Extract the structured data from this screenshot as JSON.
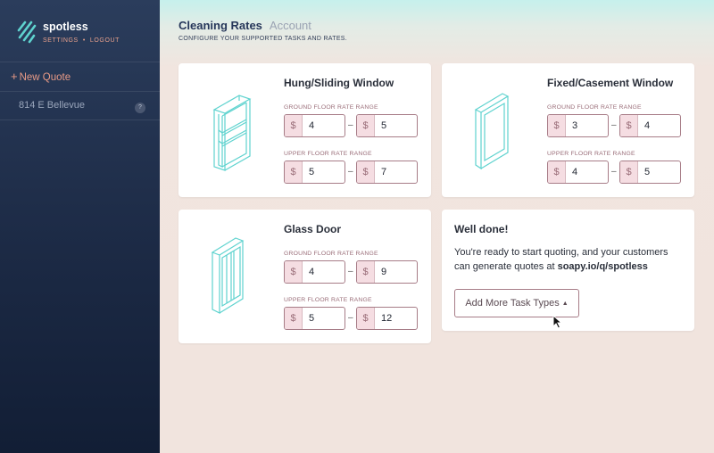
{
  "sidebar": {
    "brand": "spotless",
    "links": [
      "SETTINGS",
      "LOGOUT"
    ],
    "new_quote": "New Quote",
    "quotes": [
      {
        "address": "814 E Bellevue",
        "badge": "?"
      }
    ]
  },
  "header": {
    "tabs": [
      "Cleaning Rates",
      "Account"
    ],
    "subtitle": "CONFIGURE YOUR SUPPORTED TASKS AND RATES."
  },
  "ground_label": "GROUND FLOOR RATE RANGE",
  "upper_label": "UPPER FLOOR RATE RANGE",
  "currency": "$",
  "dash": "–",
  "tasks": [
    {
      "title": "Hung/Sliding Window",
      "icon": "hung-window-icon",
      "ground": [
        "4",
        "5"
      ],
      "upper": [
        "5",
        "7"
      ]
    },
    {
      "title": "Fixed/Casement Window",
      "icon": "casement-window-icon",
      "ground": [
        "3",
        "4"
      ],
      "upper": [
        "4",
        "5"
      ]
    },
    {
      "title": "Glass Door",
      "icon": "glass-door-icon",
      "ground": [
        "4",
        "9"
      ],
      "upper": [
        "5",
        "12"
      ]
    }
  ],
  "done_card": {
    "title": "Well done!",
    "text_prefix": "You're ready to start quoting, and your customers can generate quotes at ",
    "url": "soapy.io/q/spotless",
    "button": "Add More Task Types",
    "caret": "▲"
  },
  "colors": {
    "accent": "#e79a86",
    "sidebar": "#1c2a45",
    "illustration": "#5fd3cf",
    "field_border": "#a77c87"
  }
}
